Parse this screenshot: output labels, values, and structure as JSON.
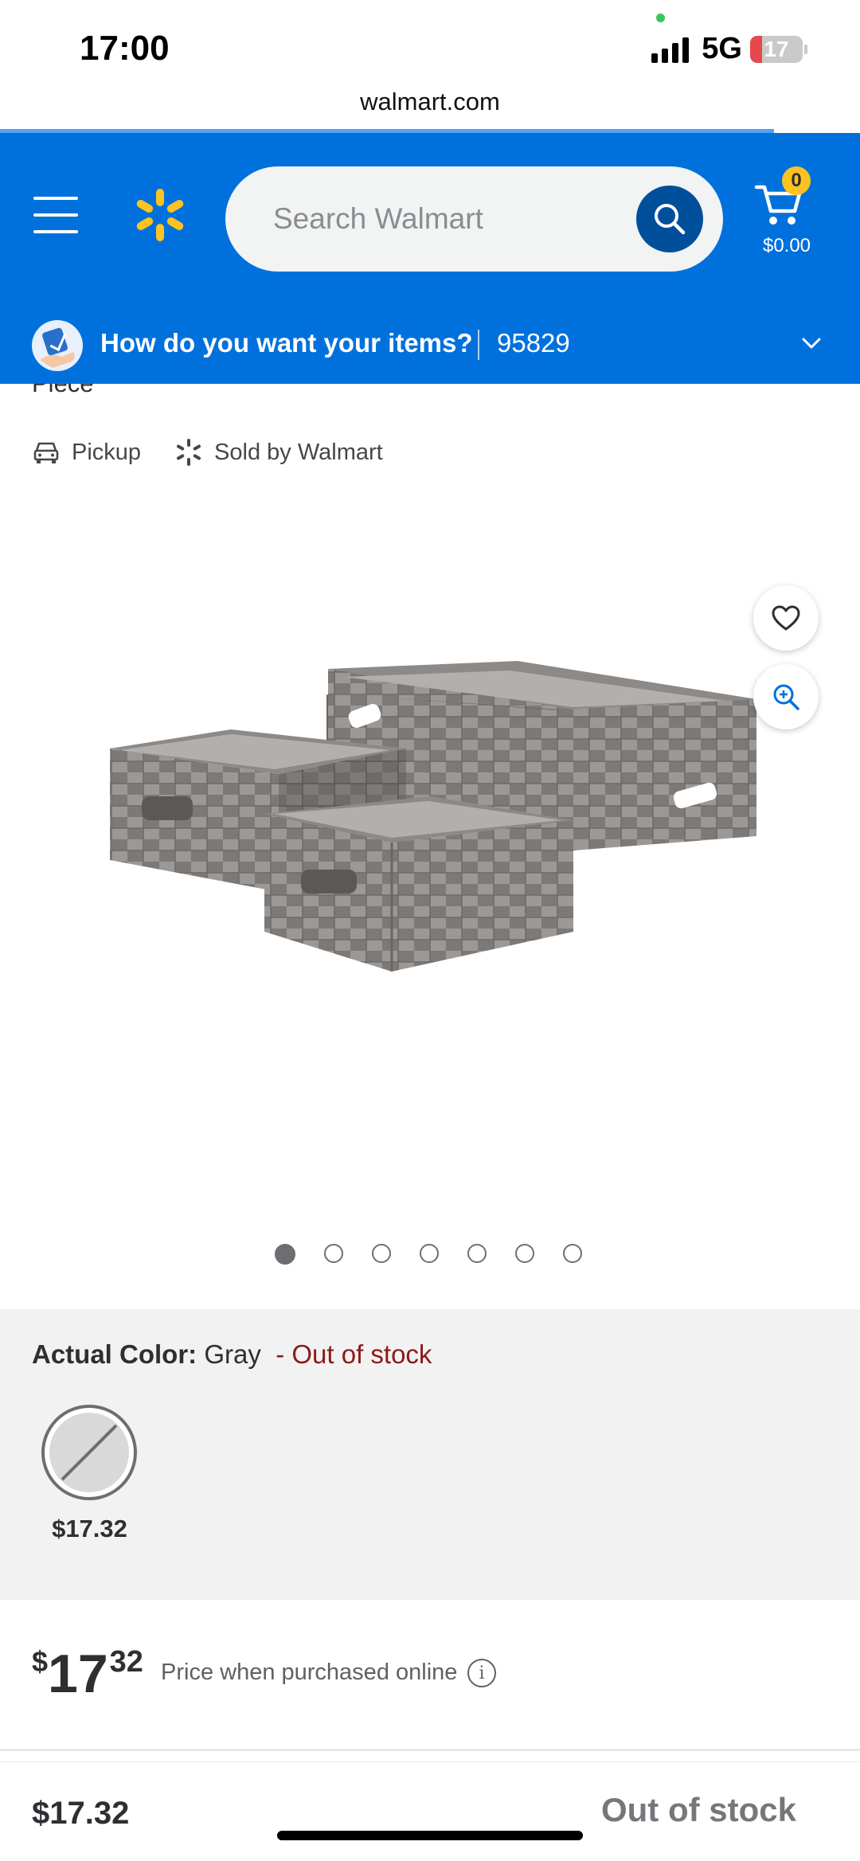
{
  "status_bar": {
    "time": "17:00",
    "network": "5G",
    "battery": "17"
  },
  "browser": {
    "url": "walmart.com"
  },
  "header": {
    "search_placeholder": "Search Walmart",
    "cart_count": "0",
    "cart_total": "$0.00",
    "colors": {
      "brand_blue": "#0071dc",
      "spark_yellow": "#ffc220",
      "search_button": "#004f9a"
    }
  },
  "fulfillment": {
    "question": "How do you want your items?",
    "zip": "95829"
  },
  "product": {
    "title_fragment": "Piece",
    "badges": [
      {
        "label": "Pickup",
        "icon": "car-icon"
      },
      {
        "label": "Sold by Walmart",
        "icon": "walmart-spark-icon"
      }
    ],
    "image_count": 7,
    "active_image": 1
  },
  "variant": {
    "label": "Actual Color:",
    "value": "Gray",
    "status": "- Out of stock",
    "swatch_price": "$17.32",
    "status_color": "#8b1a1a"
  },
  "price": {
    "currency": "$",
    "dollars": "17",
    "cents": "32",
    "note": "Price when purchased online",
    "info": "i"
  },
  "bottom_bar": {
    "price": "$17.32",
    "status": "Out of stock"
  }
}
